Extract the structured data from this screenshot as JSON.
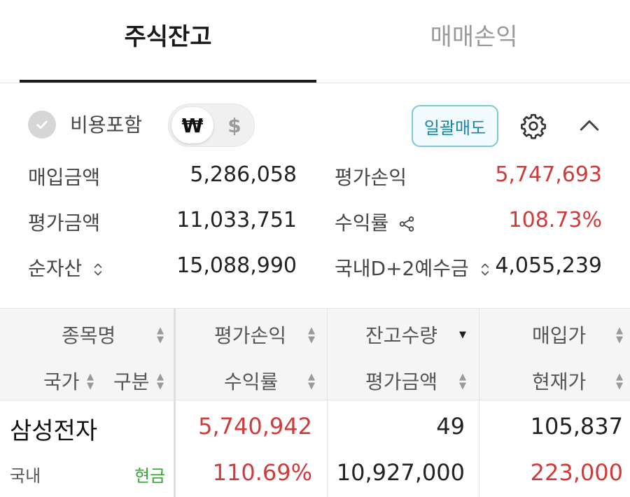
{
  "tabs": [
    {
      "label": "주식잔고",
      "active": true
    },
    {
      "label": "매매손익",
      "active": false
    }
  ],
  "controls": {
    "include_fee_label": "비용포함",
    "include_fee_checked": true,
    "currency_krw": "₩",
    "currency_usd": "$",
    "currency_selected": "KRW",
    "sell_all_label": "일괄매도",
    "icons": [
      "check-icon",
      "gear-icon",
      "chevron-up-icon"
    ]
  },
  "summary": {
    "purchase_amount_label": "매입금액",
    "purchase_amount_value": "5,286,058",
    "eval_pl_label": "평가손익",
    "eval_pl_value": "5,747,693",
    "eval_amount_label": "평가금액",
    "eval_amount_value": "11,033,751",
    "return_rate_label": "수익률",
    "return_rate_value": "108.73%",
    "net_assets_label": "순자산",
    "net_assets_value": "15,088,990",
    "domestic_deposit_label": "국내D+2예수금",
    "domestic_deposit_value": "4,055,239"
  },
  "table": {
    "headers": {
      "name": "종목명",
      "country": "국가",
      "type": "구분",
      "eval_pl": "평가손익",
      "return_rate": "수익률",
      "quantity": "잔고수량",
      "eval_amount": "평가금액",
      "purchase_price": "매입가",
      "current_price": "현재가"
    },
    "rows": [
      {
        "name": "삼성전자",
        "country": "국내",
        "type": "현금",
        "eval_pl": "5,740,942",
        "return_rate": "110.69%",
        "quantity": "49",
        "eval_amount": "10,927,000",
        "purchase_price": "105,837",
        "current_price": "223,000"
      }
    ]
  },
  "colors": {
    "profit_red": "#d23a3a",
    "accent_teal": "#1a84a4",
    "cash_green": "#3aa33a"
  }
}
